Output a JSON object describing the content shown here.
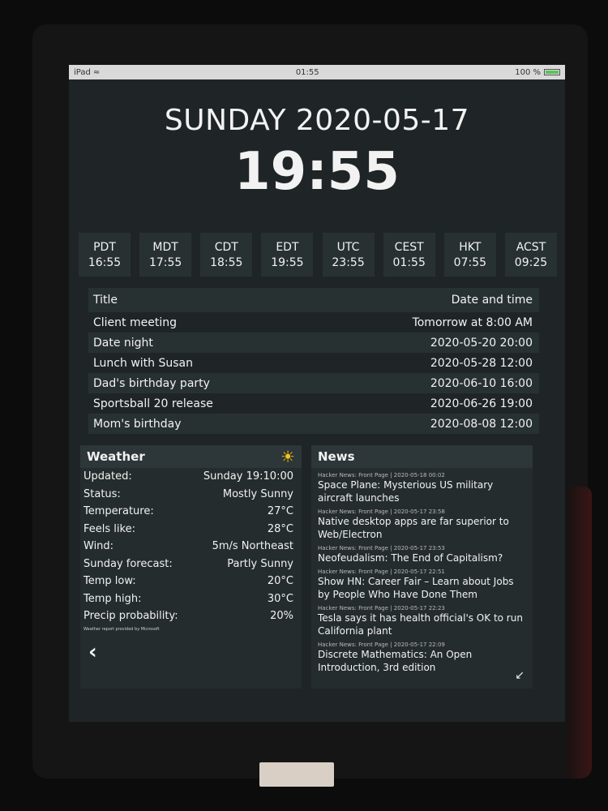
{
  "statusbar": {
    "device": "iPad",
    "time": "01:55",
    "battery": "100 %"
  },
  "header": {
    "date": "SUNDAY 2020-05-17",
    "time": "19:55"
  },
  "timezones": [
    {
      "abbr": "PDT",
      "time": "16:55"
    },
    {
      "abbr": "MDT",
      "time": "17:55"
    },
    {
      "abbr": "CDT",
      "time": "18:55"
    },
    {
      "abbr": "EDT",
      "time": "19:55"
    },
    {
      "abbr": "UTC",
      "time": "23:55"
    },
    {
      "abbr": "CEST",
      "time": "01:55"
    },
    {
      "abbr": "HKT",
      "time": "07:55"
    },
    {
      "abbr": "ACST",
      "time": "09:25"
    }
  ],
  "events": {
    "headers": {
      "title": "Title",
      "datetime": "Date and time"
    },
    "rows": [
      {
        "title": "Client meeting",
        "when": "Tomorrow at 8:00 AM"
      },
      {
        "title": "Date night",
        "when": "2020-05-20 20:00"
      },
      {
        "title": "Lunch with Susan",
        "when": "2020-05-28 12:00"
      },
      {
        "title": "Dad's birthday party",
        "when": "2020-06-10 16:00"
      },
      {
        "title": "Sportsball 20 release",
        "when": "2020-06-26 19:00"
      },
      {
        "title": "Mom's birthday",
        "when": "2020-08-08 12:00"
      }
    ]
  },
  "weather": {
    "title": "Weather",
    "icon": "sun-icon",
    "rows": [
      {
        "label": "Updated:",
        "value": "Sunday 19:10:00"
      },
      {
        "label": "Status:",
        "value": "Mostly Sunny"
      },
      {
        "label": "Temperature:",
        "value": "27°C"
      },
      {
        "label": "Feels like:",
        "value": "28°C"
      },
      {
        "label": "Wind:",
        "value": "5m/s Northeast"
      },
      {
        "label": "Sunday forecast:",
        "value": "Partly Sunny"
      },
      {
        "label": "Temp low:",
        "value": "20°C"
      },
      {
        "label": "Temp high:",
        "value": "30°C"
      },
      {
        "label": "Precip probability:",
        "value": "20%"
      }
    ],
    "credit": "Weather report provided by Microsoft"
  },
  "news": {
    "title": "News",
    "items": [
      {
        "meta": "Hacker News: Front Page | 2020-05-18 00:02",
        "title": "Space Plane: Mysterious US military aircraft launches"
      },
      {
        "meta": "Hacker News: Front Page | 2020-05-17 23:58",
        "title": "Native desktop apps are far superior to Web/Electron"
      },
      {
        "meta": "Hacker News: Front Page | 2020-05-17 23:53",
        "title": "Neofeudalism: The End of Capitalism?"
      },
      {
        "meta": "Hacker News: Front Page | 2020-05-17 22:51",
        "title": "Show HN: Career Fair – Learn about Jobs by People Who Have Done Them"
      },
      {
        "meta": "Hacker News: Front Page | 2020-05-17 22:23",
        "title": "Tesla says it has health official's OK to run California plant"
      },
      {
        "meta": "Hacker News: Front Page | 2020-05-17 22:09",
        "title": "Discrete Mathematics: An Open Introduction, 3rd edition"
      }
    ]
  }
}
